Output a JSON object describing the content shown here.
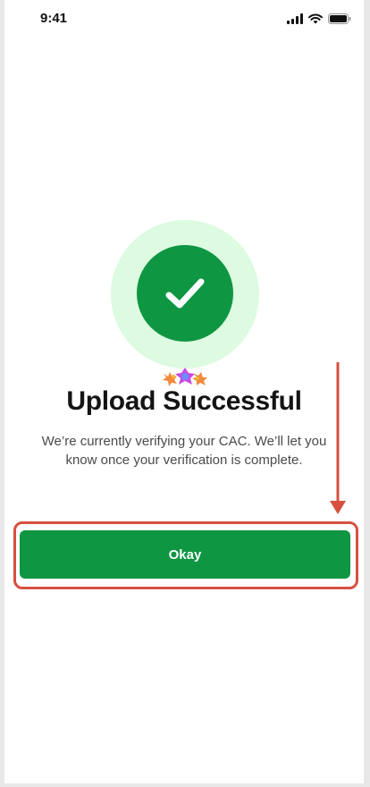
{
  "status_bar": {
    "time": "9:41",
    "icons": [
      "signal-icon",
      "wifi-icon",
      "battery-icon"
    ]
  },
  "success_icon": "check-icon",
  "title": "Upload Successful",
  "description": "We’re currently verifying your CAC. We’ll let you know once your verification is complete.",
  "okay_button": {
    "label": "Okay"
  },
  "colors": {
    "primary": "#0e9643",
    "success_halo": "#dcfbe0",
    "annotation": "#d65040",
    "title": "#141414",
    "body_text": "#4a4a4a"
  }
}
